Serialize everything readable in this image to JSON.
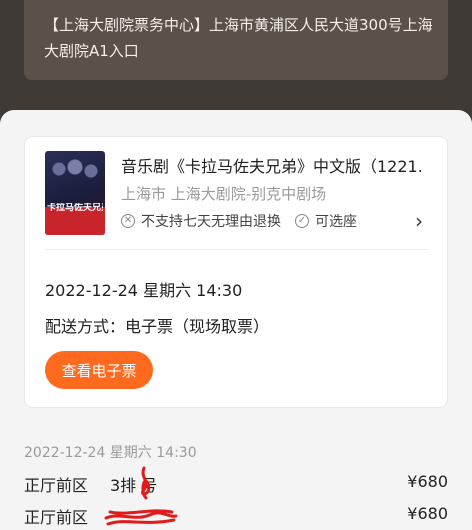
{
  "address": {
    "text": "【上海大剧院票务中心】上海市黄浦区人民大道300号上海大剧院A1入口"
  },
  "order": {
    "poster": {
      "image_text": "卡拉马佐夫兄弟"
    },
    "title": "音乐剧《卡拉马佐夫兄弟》中文版（1221...",
    "venue": "上海市 上海大剧院-别克中剧场",
    "policies": [
      {
        "icon": "circle-x-icon",
        "label": "不支持七天无理由退换"
      },
      {
        "icon": "circle-check-icon",
        "label": "可选座"
      }
    ],
    "datetime": "2022-12-24 星期六 14:30",
    "delivery": "配送方式：电子票（现场取票）",
    "eticket_button": "查看电子票"
  },
  "tickets": {
    "date": "2022-12-24 星期六 14:30",
    "rows": [
      {
        "area": "正厅前区",
        "seat": "3排 号",
        "price": "¥680"
      },
      {
        "area": "正厅前区",
        "seat": "",
        "price": "¥680"
      }
    ]
  },
  "colors": {
    "accent": "#ff6a1e",
    "scribble": "#e11b1b"
  }
}
